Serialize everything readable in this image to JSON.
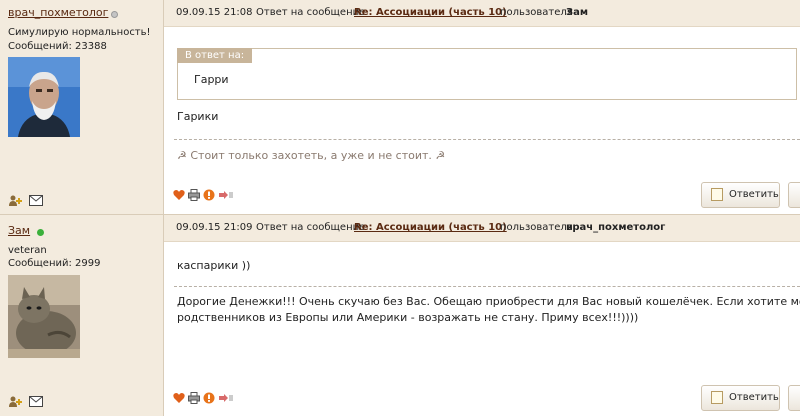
{
  "posts": [
    {
      "author": {
        "name": "врач_похметолог",
        "status": "offline",
        "status_color": "#bbbbbb",
        "title": "Симулирую нормальность!",
        "messages": "Сообщений: 23388"
      },
      "header": {
        "datetime": "09.09.15 21:08",
        "reply_to_prefix": "Ответ на сообщение",
        "topic": "Re: Ассоциации (часть 10)",
        "by_prefix": "пользователя",
        "reply_user": "Зам"
      },
      "quote": {
        "label": "В ответ на:",
        "text": "Гарри"
      },
      "body": [
        "Гарики"
      ],
      "signature": "☭ Стоит только захотеть, а уже и не стоит. ☭",
      "reply_label": "Ответить"
    },
    {
      "author": {
        "name": "Зам",
        "status": "online",
        "status_color": "#3bb03b",
        "title": "veteran",
        "messages": "Сообщений: 2999"
      },
      "header": {
        "datetime": "09.09.15 21:09",
        "reply_to_prefix": "Ответ на сообщение",
        "topic": "Re: Ассоциации (часть 10)",
        "by_prefix": "пользователя",
        "reply_user": "врач_похметолог"
      },
      "body": [
        "каспарики ))"
      ],
      "signature_lines": [
        "Дорогие Денежки!!! Очень скучаю без Вас. Обещаю приобрести для Вас новый кошелёчек. Если хотите можете",
        "родственников из Европы или Америки - возражать не стану. Приму всех!!!))))"
      ],
      "reply_label": "Ответить"
    }
  ],
  "icons": {
    "add_friend": "add-friend-icon",
    "message": "envelope-icon",
    "like": "heart-icon",
    "print": "printer-icon",
    "complaint": "warning-icon",
    "quote": "quote-icon",
    "reply": "reply-icon"
  },
  "colors": {
    "sidebar_bg": "#f3ebde",
    "link": "#5a2a12",
    "quote_label_bg": "#c8b59a"
  }
}
